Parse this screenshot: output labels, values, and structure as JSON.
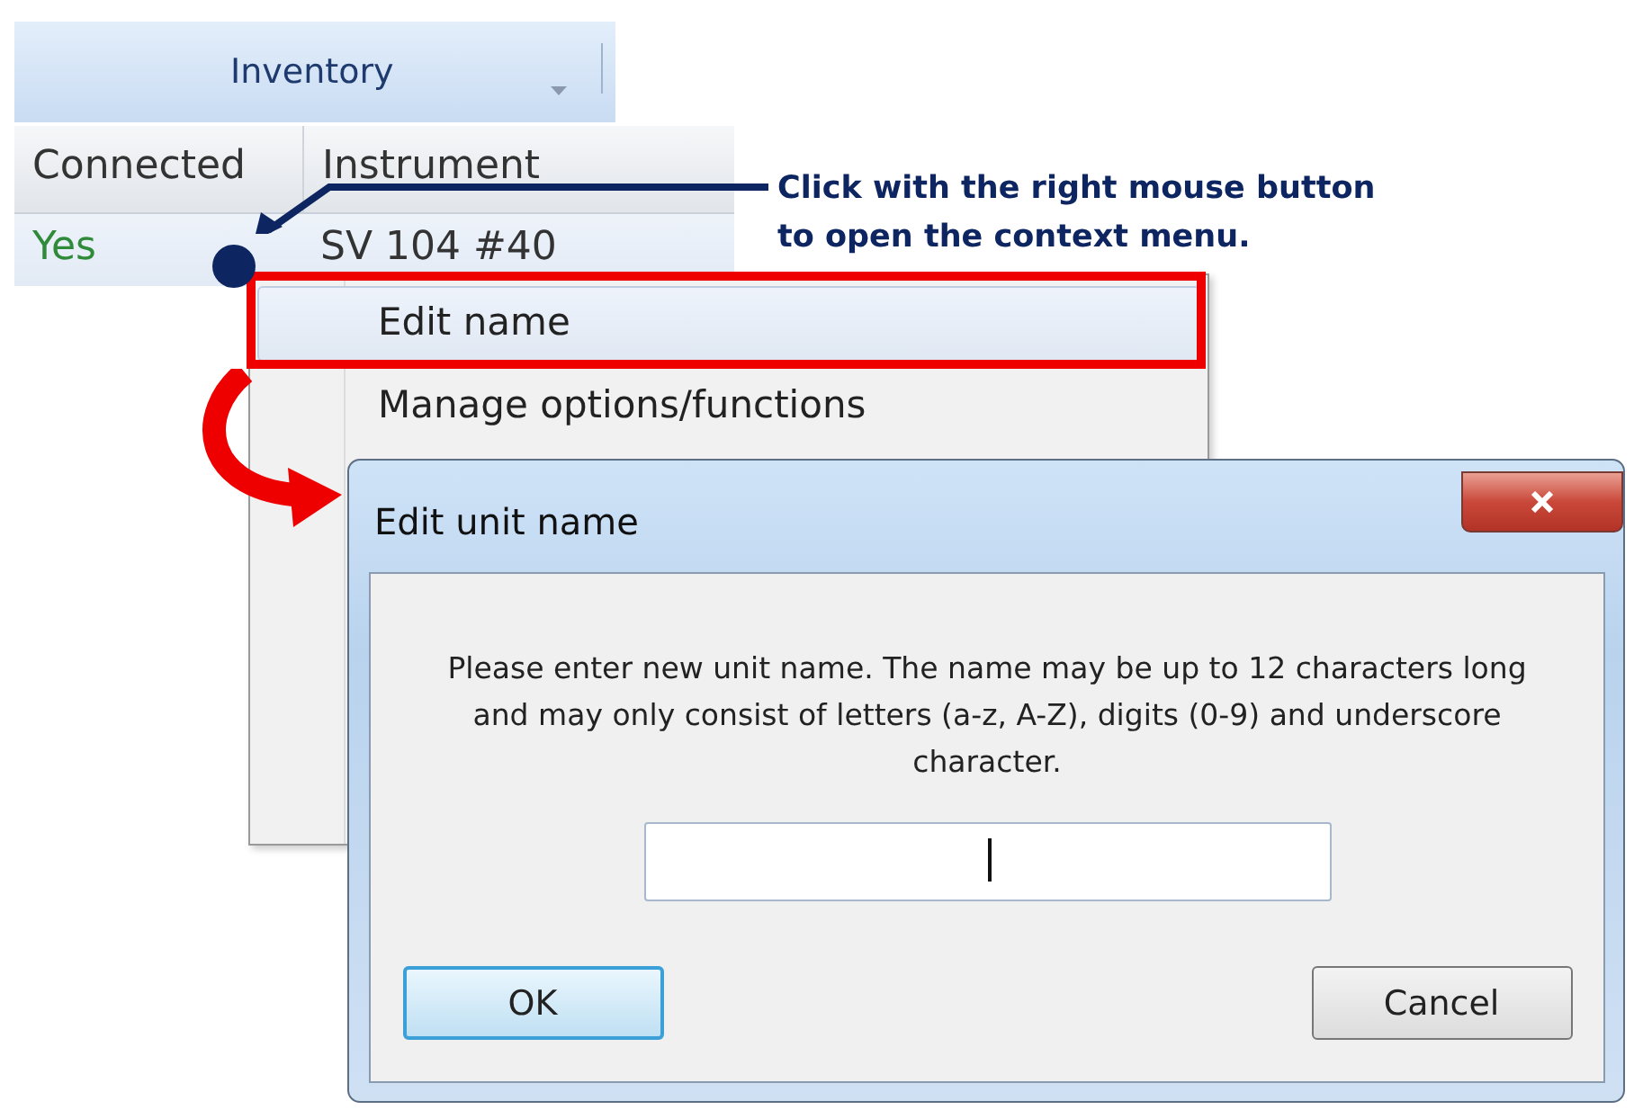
{
  "inventory_header": {
    "title": "Inventory"
  },
  "grid": {
    "columns": [
      "Connected",
      "Instrument"
    ],
    "rows": [
      {
        "cells": [
          "Yes",
          "SV 104 #40"
        ]
      }
    ]
  },
  "context_menu": {
    "items": [
      {
        "label": "Edit name",
        "selected": true
      },
      {
        "label": "Manage options/functions",
        "selected": false
      }
    ]
  },
  "annotation": {
    "text": "Click with the right mouse button to open the context menu."
  },
  "dialog": {
    "title": "Edit unit name",
    "message": "Please enter new unit name. The name may be up to 12 characters long and may only consist of letters (a-z, A-Z), digits (0-9) and underscore character.",
    "input": {
      "focused": true
    },
    "buttons": [
      {
        "label": "OK",
        "default": true
      },
      {
        "label": "Cancel",
        "default": false
      }
    ]
  }
}
